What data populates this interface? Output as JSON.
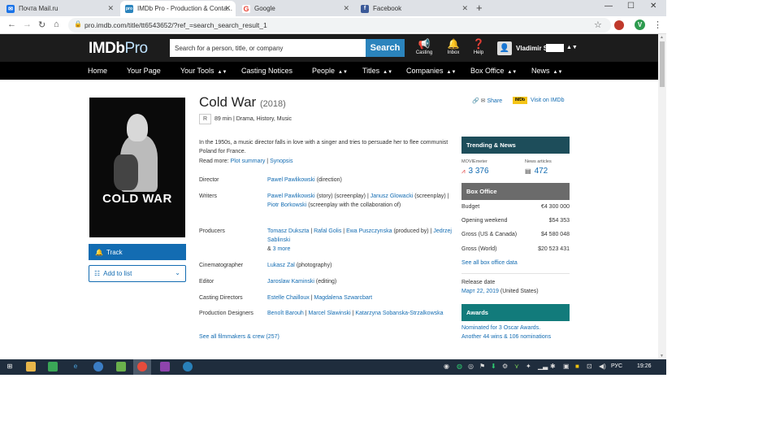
{
  "browser": {
    "tabs": [
      {
        "label": "Почта Mail.ru",
        "favicon": "mail-icon",
        "color": "#1a73e8"
      },
      {
        "label": "IMDb Pro - Production & Conta...",
        "favicon": "imdbpro-icon",
        "color": "#2b84bd"
      },
      {
        "label": "Google",
        "favicon": "google-icon",
        "color": "#ea4335"
      },
      {
        "label": "Facebook",
        "favicon": "facebook-icon",
        "color": "#3b5998"
      }
    ],
    "url": "pro.imdb.com/title/tt6543652/?ref_=search_search_result_1",
    "profile_initial": "V"
  },
  "header": {
    "logo_main": "IMDb",
    "logo_pro": "Pro",
    "search_placeholder": "Search for a person, title, or company",
    "search_button": "Search",
    "icons": [
      {
        "label": "Casting",
        "icon": "megaphone-icon"
      },
      {
        "label": "Inbox",
        "icon": "bell-icon"
      },
      {
        "label": "Help",
        "icon": "help-icon"
      }
    ],
    "user_name": "Vladimir S"
  },
  "nav": [
    {
      "label": "Home",
      "dropdown": false
    },
    {
      "label": "Your Page",
      "dropdown": false
    },
    {
      "label": "Your Tools",
      "dropdown": true
    },
    {
      "label": "Casting Notices",
      "dropdown": false
    },
    {
      "label": "People",
      "dropdown": true
    },
    {
      "label": "Titles",
      "dropdown": true
    },
    {
      "label": "Companies",
      "dropdown": true
    },
    {
      "label": "Box Office",
      "dropdown": true
    },
    {
      "label": "News",
      "dropdown": true
    }
  ],
  "poster": {
    "title": "COLD WAR"
  },
  "actions": {
    "track": "Track",
    "add_to_list": "Add to list"
  },
  "title": {
    "name": "Cold War",
    "year": "(2018)",
    "rating": "R",
    "meta": "89 min | Drama, History, Music",
    "share": "Share",
    "imdb_badge": "IMDb",
    "visit": "Visit on IMDb",
    "plot": "In the 1950s, a music director falls in love with a singer and tries to persuade her to flee communist Poland for France.",
    "read_more_label": "Read more:",
    "plot_summary": "Plot summary",
    "synopsis": "Synopsis"
  },
  "crew": {
    "director_label": "Director",
    "director_name": "Pawel Pawlikowski",
    "director_role": "(direction)",
    "writers_label": "Writers",
    "writer1_name": "Pawel Pawlikowski",
    "writer1_role": "(story) (screenplay)",
    "writer2_name": "Janusz Glowacki",
    "writer2_role": "(screenplay)",
    "writer3_name": "Piotr Borkowski",
    "writer3_role": "(screenplay with the collaboration of)",
    "producers_label": "Producers",
    "producer1": "Tomasz Dukszta",
    "producer2": "Rafal Golis",
    "producer3_name": "Ewa Puszczynska",
    "producer3_role": "(produced by)",
    "producer4": "Jedrzej Sablinski",
    "producers_more_prefix": "& ",
    "producers_more": "3 more",
    "cinematographer_label": "Cinematographer",
    "cinematographer_name": "Lukasz Zal",
    "cinematographer_role": "(photography)",
    "editor_label": "Editor",
    "editor_name": "Jaroslaw Kaminski",
    "editor_role": "(editing)",
    "casting_label": "Casting Directors",
    "casting1": "Estelle Chailloux",
    "casting2": "Magdalena Szwarcbart",
    "design_label": "Production Designers",
    "design1": "Benoît Barouh",
    "design2": "Marcel Slawinski",
    "design3": "Katarzyna Sobanska-Strzalkowska",
    "see_all": "See all filmmakers & crew (257)"
  },
  "sidebar": {
    "trending_head": "Trending & News",
    "moviemeter_label": "MOVIEmeter",
    "moviemeter_value": "3 376",
    "news_label": "News articles",
    "news_value": "472",
    "boxoffice_head": "Box Office",
    "boxoffice": [
      {
        "label": "Budget",
        "value": "€4 300 000"
      },
      {
        "label": "Opening weekend",
        "value": "$54 353"
      },
      {
        "label": "Gross (US & Canada)",
        "value": "$4 580 048"
      },
      {
        "label": "Gross (World)",
        "value": "$20 523 431"
      }
    ],
    "boxoffice_link": "See all box office data",
    "release_label": "Release date",
    "release_date": "Март 22, 2019",
    "release_country": "(United States)",
    "awards_head": "Awards",
    "awards_line1": "Nominated for 3 Oscar Awards.",
    "awards_line2": "Another 44 wins & 106 nominations"
  },
  "taskbar": {
    "lang": "РУС",
    "time": "19:26"
  }
}
